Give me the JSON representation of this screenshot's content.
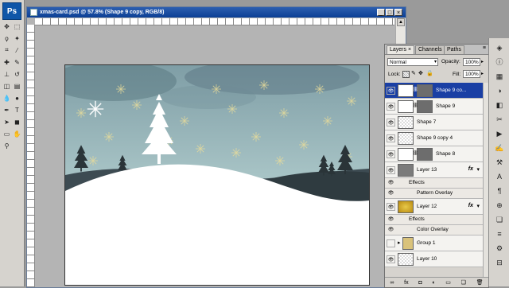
{
  "app": {
    "logo_text": "Ps"
  },
  "document": {
    "title": "xmas-card.psd @ 57.8% (Shape 9 copy, RGB/8)",
    "minimize": "_",
    "maximize": "□",
    "close": "×"
  },
  "colors": {
    "accent": "#1a3fa4",
    "sky": "#8fb0b5",
    "snow": "#ffffff",
    "hills": "#3d4b52",
    "canvas_bg": "#b4b4b4"
  },
  "tools": [
    {
      "name": "move-tool-icon",
      "glyph": "✥"
    },
    {
      "name": "marquee-tool-icon",
      "glyph": "⬚"
    },
    {
      "name": "lasso-tool-icon",
      "glyph": "ϙ"
    },
    {
      "name": "magic-wand-tool-icon",
      "glyph": "✦"
    },
    {
      "name": "crop-tool-icon",
      "glyph": "⌗"
    },
    {
      "name": "eyedropper-tool-icon",
      "glyph": "⁄"
    },
    {
      "name": "healing-brush-tool-icon",
      "glyph": "✚"
    },
    {
      "name": "brush-tool-icon",
      "glyph": "✎"
    },
    {
      "name": "clone-stamp-tool-icon",
      "glyph": "⊥"
    },
    {
      "name": "history-brush-tool-icon",
      "glyph": "↺"
    },
    {
      "name": "eraser-tool-icon",
      "glyph": "◫"
    },
    {
      "name": "gradient-tool-icon",
      "glyph": "▤"
    },
    {
      "name": "blur-tool-icon",
      "glyph": "💧"
    },
    {
      "name": "dodge-tool-icon",
      "glyph": "●"
    },
    {
      "name": "pen-tool-icon",
      "glyph": "✒"
    },
    {
      "name": "type-tool-icon",
      "glyph": "T"
    },
    {
      "name": "path-selection-tool-icon",
      "glyph": "➤"
    },
    {
      "name": "shape-tool-icon",
      "glyph": "◼"
    },
    {
      "name": "notes-tool-icon",
      "glyph": "▭"
    },
    {
      "name": "hand-tool-icon",
      "glyph": "✋"
    },
    {
      "name": "zoom-tool-icon",
      "glyph": "⚲"
    }
  ],
  "layers_panel": {
    "tabs": [
      "Layers",
      "Channels",
      "Paths"
    ],
    "tab_close": "×",
    "blend_mode": "Normal",
    "opacity_label": "Opacity:",
    "opacity_value": "100%",
    "lock_label": "Lock:",
    "fill_label": "Fill:",
    "fill_value": "100%",
    "layers": [
      {
        "name": "Shape 9 co...",
        "visible": true,
        "selected": true,
        "type": "shape"
      },
      {
        "name": "Shape 9",
        "visible": true,
        "selected": false,
        "type": "shape"
      },
      {
        "name": "Shape 7",
        "visible": true,
        "selected": false,
        "type": "raster"
      },
      {
        "name": "Shape 9 copy 4",
        "visible": true,
        "selected": false,
        "type": "raster"
      },
      {
        "name": "Shape 8",
        "visible": true,
        "selected": false,
        "type": "shape"
      },
      {
        "name": "Layer 13",
        "visible": true,
        "selected": false,
        "type": "gray",
        "fx": "fx"
      },
      {
        "name": "Effects",
        "sub": true
      },
      {
        "name": "Pattern Overlay",
        "sub": true,
        "effect": true
      },
      {
        "name": "Layer 12",
        "visible": true,
        "selected": false,
        "type": "gold",
        "fx": "fx"
      },
      {
        "name": "Effects",
        "sub": true
      },
      {
        "name": "Color Overlay",
        "sub": true,
        "effect": true
      },
      {
        "name": "Group 1",
        "visible": false,
        "selected": false,
        "type": "group"
      },
      {
        "name": "Layer 10",
        "visible": true,
        "selected": false,
        "type": "raster"
      }
    ],
    "bottom_icons": [
      "link-layers-icon",
      "fx-icon",
      "mask-icon",
      "adjustment-icon",
      "group-icon",
      "new-layer-icon",
      "trash-icon"
    ],
    "bottom_glyphs": [
      "∞",
      "fx",
      "◘",
      "◐",
      "▭",
      "❏",
      "🗑"
    ]
  },
  "dock_icons": [
    {
      "name": "navigator-icon",
      "glyph": "◈"
    },
    {
      "name": "info-icon",
      "glyph": "ⓘ"
    },
    {
      "name": "swatches-icon",
      "glyph": "▦"
    },
    {
      "name": "color-icon",
      "glyph": "◑"
    },
    {
      "name": "styles-icon",
      "glyph": "◧"
    },
    {
      "name": "history-icon",
      "glyph": "✂"
    },
    {
      "name": "actions-icon",
      "glyph": "▶"
    },
    {
      "name": "brushes-icon",
      "glyph": "✍"
    },
    {
      "name": "tool-presets-icon",
      "glyph": "⚒"
    },
    {
      "name": "character-icon",
      "glyph": "A"
    },
    {
      "name": "paragraph-icon",
      "glyph": "¶"
    },
    {
      "name": "clone-source-icon",
      "glyph": "⊕"
    },
    {
      "name": "layer-comps-icon",
      "glyph": "❏"
    },
    {
      "name": "properties-icon",
      "glyph": "≡"
    },
    {
      "name": "adjustments-icon",
      "glyph": "⚙"
    },
    {
      "name": "masks-icon",
      "glyph": "⊟"
    }
  ]
}
